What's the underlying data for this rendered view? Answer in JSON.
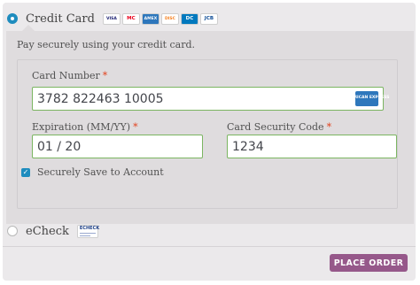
{
  "payment_methods": {
    "credit_card": {
      "label": "Credit Card",
      "selected": true,
      "card_icons": [
        {
          "name": "visa-icon",
          "text": "VISA",
          "bg": "#ffffff",
          "fg": "#1a1f71"
        },
        {
          "name": "mastercard-icon",
          "text": "MC",
          "bg": "#ffffff",
          "fg": "#eb001b"
        },
        {
          "name": "amex-icon",
          "text": "AMEX",
          "bg": "#2e77bc",
          "fg": "#ffffff"
        },
        {
          "name": "discover-icon",
          "text": "DISC",
          "bg": "#ffffff",
          "fg": "#f68121"
        },
        {
          "name": "diners-icon",
          "text": "DC",
          "bg": "#0079be",
          "fg": "#ffffff"
        },
        {
          "name": "jcb-icon",
          "text": "JCB",
          "bg": "#ffffff",
          "fg": "#0e4c96"
        }
      ]
    },
    "echeck": {
      "label": "eCheck",
      "selected": false,
      "icon_text": "ECHECK"
    }
  },
  "panel": {
    "description": "Pay securely using your credit card.",
    "card_number": {
      "label": "Card Number",
      "required_mark": "*",
      "value": "3782 822463 10005",
      "brand_badge": "AMERICAN EXPRESS"
    },
    "expiration": {
      "label": "Expiration (MM/YY)",
      "required_mark": "*",
      "value": "01 / 20"
    },
    "security_code": {
      "label": "Card Security Code",
      "required_mark": "*",
      "value": "1234"
    },
    "save_account": {
      "label": "Securely Save to Account",
      "checked": true
    }
  },
  "actions": {
    "place_order_label": "PLACE ORDER"
  },
  "colors": {
    "accent": "#1e8cbe",
    "button": "#96588a",
    "input_border": "#7bb561",
    "required": "#e2401c"
  }
}
